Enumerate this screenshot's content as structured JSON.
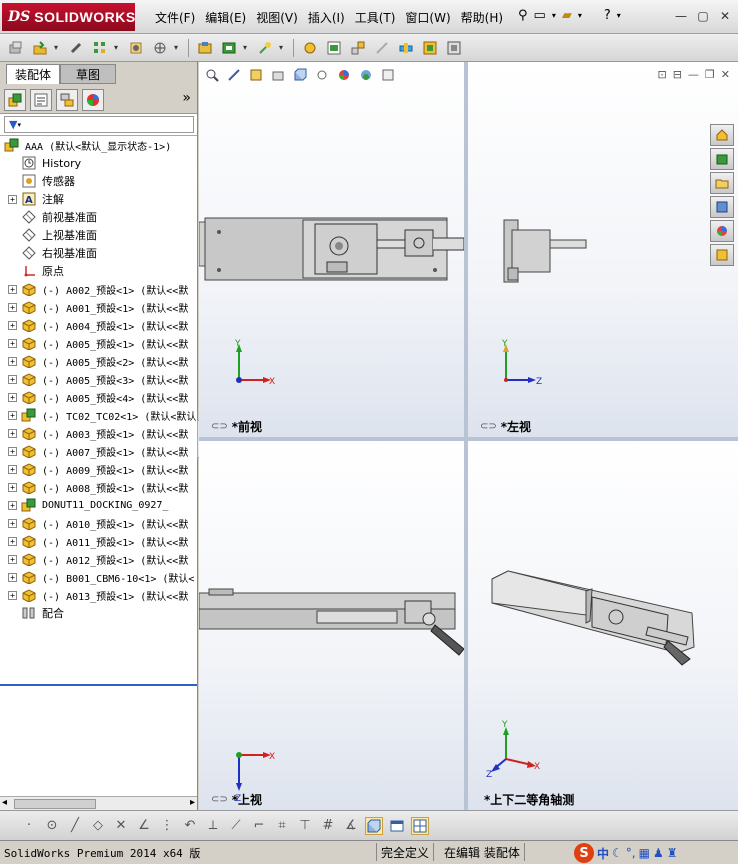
{
  "app": {
    "logo_ds": "DS",
    "logo_name": "SOLIDWORKS",
    "menus": [
      "文件(F)",
      "编辑(E)",
      "视图(V)",
      "插入(I)",
      "工具(T)",
      "窗口(W)",
      "帮助(H)"
    ]
  },
  "left_panel": {
    "tabs": [
      "装配体",
      "草图"
    ],
    "more_label": "»",
    "root": "AAA  (默认<默认_显示状态-1>)",
    "items": [
      {
        "label": "History",
        "icon": "history-icon",
        "expand": false,
        "mono": false
      },
      {
        "label": "传感器",
        "icon": "sensor-icon",
        "expand": false,
        "mono": false
      },
      {
        "label": "注解",
        "icon": "annotation-icon",
        "expand": true,
        "mono": false
      },
      {
        "label": "前视基准面",
        "icon": "plane-icon",
        "expand": false,
        "mono": false
      },
      {
        "label": "上视基准面",
        "icon": "plane-icon",
        "expand": false,
        "mono": false
      },
      {
        "label": "右视基准面",
        "icon": "plane-icon",
        "expand": false,
        "mono": false
      },
      {
        "label": "原点",
        "icon": "origin-icon",
        "expand": false,
        "mono": false
      },
      {
        "label": "(-) A002_预設<1> (默认<<默",
        "icon": "part-icon",
        "expand": true,
        "mono": true
      },
      {
        "label": "(-) A001_预設<1> (默认<<默",
        "icon": "part-icon",
        "expand": true,
        "mono": true
      },
      {
        "label": "(-) A004_预設<1> (默认<<默",
        "icon": "part-icon",
        "expand": true,
        "mono": true
      },
      {
        "label": "(-) A005_预設<1> (默认<<默",
        "icon": "part-icon",
        "expand": true,
        "mono": true
      },
      {
        "label": "(-) A005_预設<2> (默认<<默",
        "icon": "part-icon",
        "expand": true,
        "mono": true
      },
      {
        "label": "(-) A005_预設<3> (默认<<默",
        "icon": "part-icon",
        "expand": true,
        "mono": true
      },
      {
        "label": "(-) A005_预設<4> (默认<<默",
        "icon": "part-icon",
        "expand": true,
        "mono": true
      },
      {
        "label": "(-) TC02_TC02<1> (默认<默认",
        "icon": "subasm-icon",
        "expand": true,
        "mono": true
      },
      {
        "label": "(-) A003_预設<1> (默认<<默",
        "icon": "part-icon",
        "expand": true,
        "mono": true
      },
      {
        "label": "(-) A007_预設<1> (默认<<默",
        "icon": "part-icon",
        "expand": true,
        "mono": true
      },
      {
        "label": "(-) A009_预設<1> (默认<<默",
        "icon": "part-icon",
        "expand": true,
        "mono": true
      },
      {
        "label": "(-) A008_预設<1> (默认<<默",
        "icon": "part-icon",
        "expand": true,
        "mono": true
      },
      {
        "label": "DONUT11_DOCKING_0927_",
        "icon": "subasm-icon",
        "expand": true,
        "mono": true
      },
      {
        "label": "(-) A010_预設<1> (默认<<默",
        "icon": "part-icon",
        "expand": true,
        "mono": true
      },
      {
        "label": "(-) A011_预設<1> (默认<<默",
        "icon": "part-icon",
        "expand": true,
        "mono": true
      },
      {
        "label": "(-) A012_预設<1> (默认<<默",
        "icon": "part-icon",
        "expand": true,
        "mono": true
      },
      {
        "label": "(-) B001_CBM6-10<1> (默认<",
        "icon": "part-icon",
        "expand": true,
        "mono": true
      },
      {
        "label": "(-) A013_预設<1> (默认<<默",
        "icon": "part-icon",
        "expand": true,
        "mono": true
      },
      {
        "label": "配合",
        "icon": "mates-icon",
        "expand": false,
        "mono": false
      }
    ]
  },
  "viewports": {
    "front": "*前视",
    "left": "*左视",
    "top": "*上视",
    "iso": "*上下二等角轴测"
  },
  "axes": {
    "x": "X",
    "y": "Y",
    "z": "Z"
  },
  "status": {
    "product": "SolidWorks Premium 2014 x64 版",
    "state": "完全定义",
    "mode": "在编辑 装配体",
    "ime_logo": "S",
    "ime_lang": "中"
  },
  "colors": {
    "brand": "#c8102e",
    "axis_x": "#d02020",
    "axis_y": "#20a020",
    "axis_z": "#2030c0",
    "part": "#c8c8c8"
  }
}
